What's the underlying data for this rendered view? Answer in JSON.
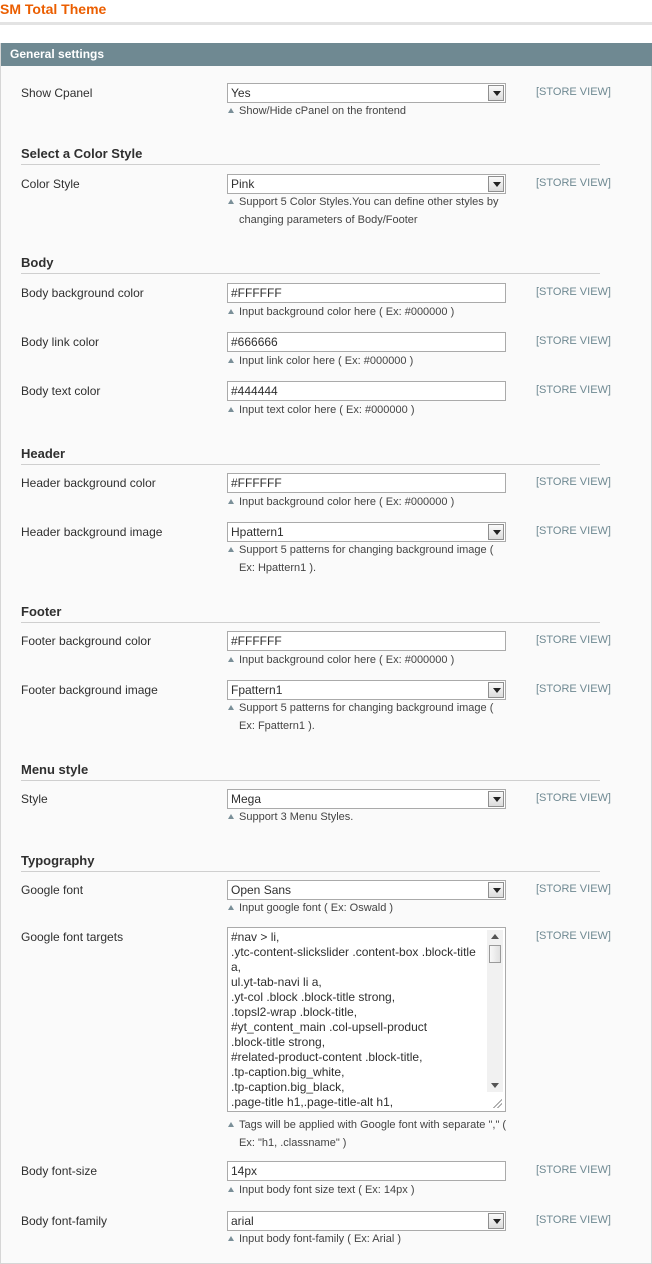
{
  "page": {
    "title": "SM Total Theme"
  },
  "fieldset": {
    "title": "General settings"
  },
  "scope_label": "[STORE VIEW]",
  "general": {
    "show_cpanel": {
      "label": "Show Cpanel",
      "value": "Yes",
      "note": "Show/Hide cPanel on the frontend"
    }
  },
  "color_style": {
    "heading": "Select a Color Style",
    "style": {
      "label": "Color Style",
      "value": "Pink",
      "note_line1": "Support 5 Color Styles.You can define other styles by",
      "note_line2": "changing parameters of Body/Footer"
    }
  },
  "body": {
    "heading": "Body",
    "bg_color": {
      "label": "Body background color",
      "value": "#FFFFFF",
      "note": "Input background color here ( Ex: #000000 )"
    },
    "link_color": {
      "label": "Body link color",
      "value": "#666666",
      "note": "Input link color here ( Ex: #000000 )"
    },
    "text_color": {
      "label": "Body text color",
      "value": "#444444",
      "note": "Input text color here ( Ex: #000000 )"
    }
  },
  "header": {
    "heading": "Header",
    "bg_color": {
      "label": "Header background color",
      "value": "#FFFFFF",
      "note": "Input background color here ( Ex: #000000 )"
    },
    "bg_image": {
      "label": "Header background image",
      "value": "Hpattern1",
      "note_line1": "Support 5 patterns for changing background image (",
      "note_line2": "Ex: Hpattern1 )."
    }
  },
  "footer": {
    "heading": "Footer",
    "bg_color": {
      "label": "Footer background color",
      "value": "#FFFFFF",
      "note": "Input background color here ( Ex: #000000 )"
    },
    "bg_image": {
      "label": "Footer background image",
      "value": "Fpattern1",
      "note_line1": "Support 5 patterns for changing background image (",
      "note_line2": "Ex: Fpattern1 )."
    }
  },
  "menu": {
    "heading": "Menu style",
    "style": {
      "label": "Style",
      "value": "Mega",
      "note": "Support 3 Menu Styles."
    }
  },
  "typography": {
    "heading": "Typography",
    "google_font": {
      "label": "Google font",
      "value": "Open Sans",
      "note": "Input google font ( Ex: Oswald )"
    },
    "google_font_targets": {
      "label": "Google font targets",
      "lines": [
        "#nav > li,",
        ".ytc-content-slickslider .content-box .block-title",
        "a,",
        "ul.yt-tab-navi li a,",
        ".yt-col .block .block-title strong,",
        ".topsl2-wrap .block-title,",
        "#yt_content_main .col-upsell-product",
        ".block-title strong,",
        "#related-product-content  .block-title,",
        ".tp-caption.big_white,",
        ".tp-caption.big_black,",
        ".page-title h1,.page-title-alt h1,"
      ],
      "note_line1": "Tags will be applied with Google font with separate \",\" (",
      "note_line2": "Ex: \"h1, .classname\" )"
    },
    "font_size": {
      "label": "Body font-size",
      "value": "14px",
      "note": "Input body font size text ( Ex: 14px )"
    },
    "font_family": {
      "label": "Body font-family",
      "value": "arial",
      "note": "Input body font-family ( Ex: Arial )"
    }
  }
}
